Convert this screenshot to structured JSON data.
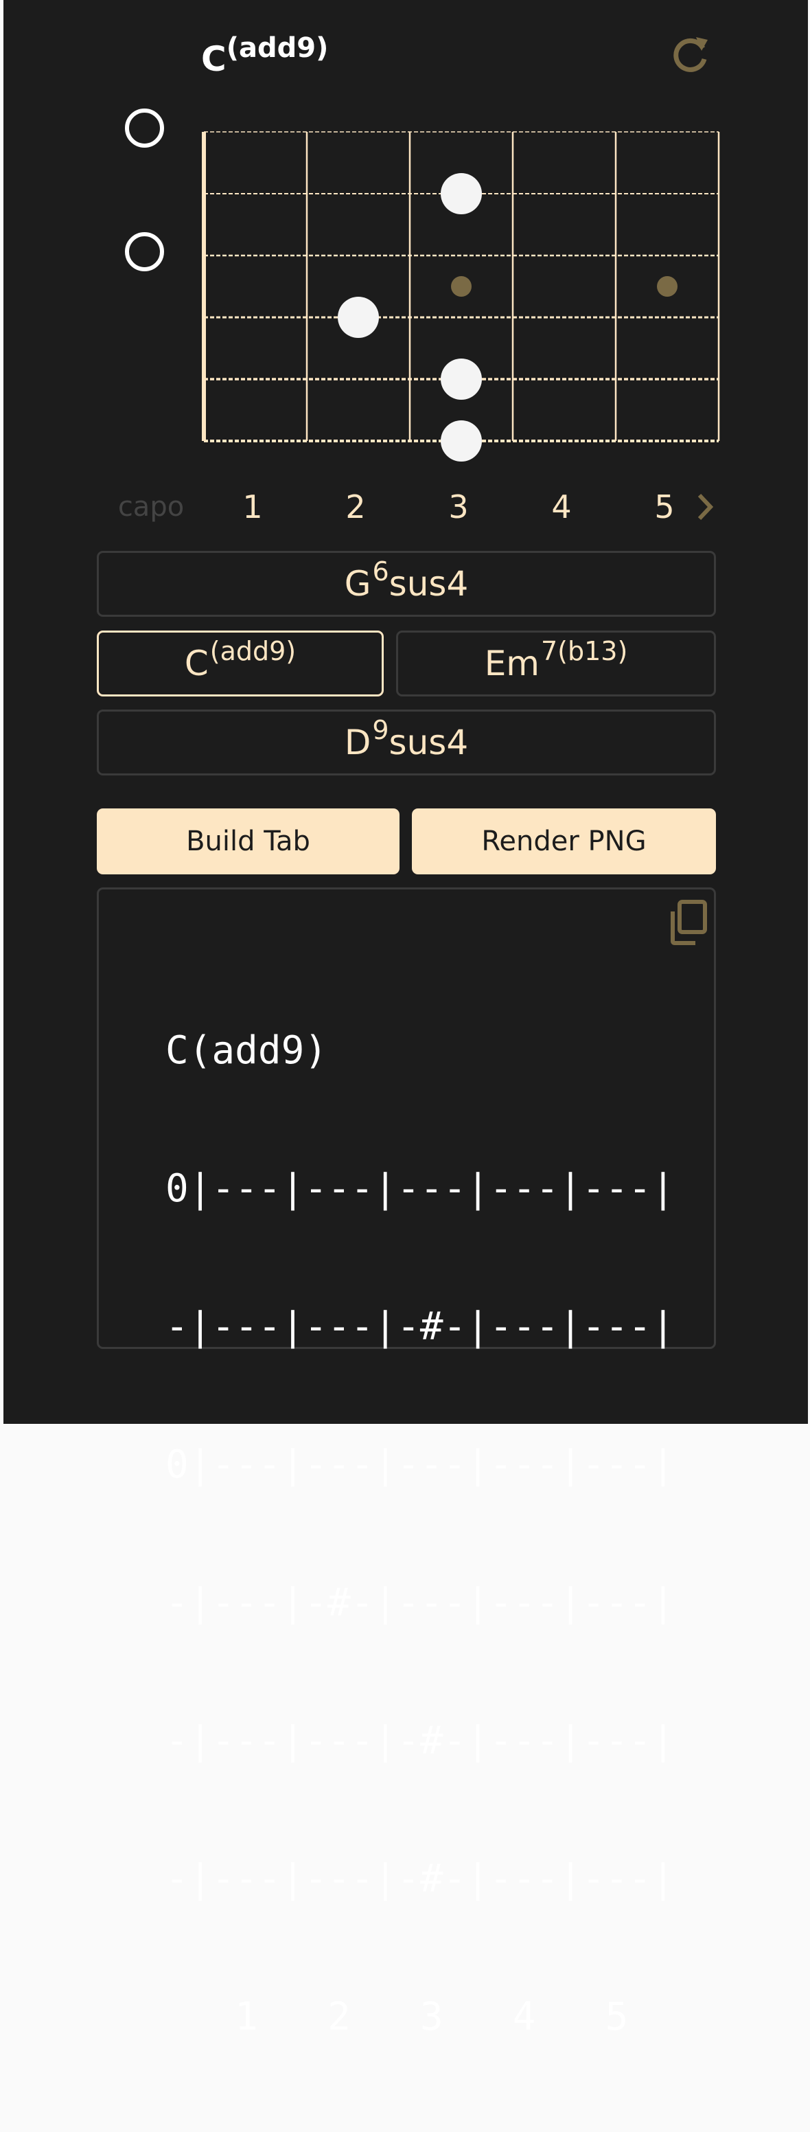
{
  "chord": {
    "root": "C",
    "extension": "(add9)"
  },
  "icons": {
    "reset": "refresh-icon",
    "next": "chevron-right-icon",
    "copy": "copy-icon"
  },
  "fretboard": {
    "open_strings": [
      1,
      3
    ],
    "notes": [
      {
        "string": 2,
        "fret": 3
      },
      {
        "string": 4,
        "fret": 2
      },
      {
        "string": 5,
        "fret": 3
      },
      {
        "string": 6,
        "fret": 3
      }
    ],
    "inlays": [
      3,
      5
    ]
  },
  "fret_labels": {
    "capo": "capo",
    "numbers": [
      "1",
      "2",
      "3",
      "4",
      "5"
    ]
  },
  "suggestions": [
    {
      "root": "G",
      "sup": "6",
      "suffix": "sus4"
    },
    {
      "root": "C",
      "sup": "(add9)",
      "suffix": ""
    },
    {
      "root": "Em",
      "sup": "7(b13)",
      "suffix": ""
    },
    {
      "root": "D",
      "sup": "9",
      "suffix": "sus4"
    }
  ],
  "actions": {
    "build_tab": "Build Tab",
    "render_png": "Render PNG"
  },
  "tab": {
    "lines": [
      "C(add9)",
      "0|---|---|---|---|---|",
      "-|---|---|-#-|---|---|",
      "0|---|---|---|---|---|",
      "-|---|-#-|---|---|---|",
      "-|---|---|-#-|---|---|",
      "-|---|---|-#-|---|---|",
      "   1   2   3   4   5"
    ]
  },
  "colors": {
    "background": "#1c1c1c",
    "accent": "#fde6c3",
    "muted_gold": "#7a6a45",
    "border": "#3a3a3a"
  }
}
